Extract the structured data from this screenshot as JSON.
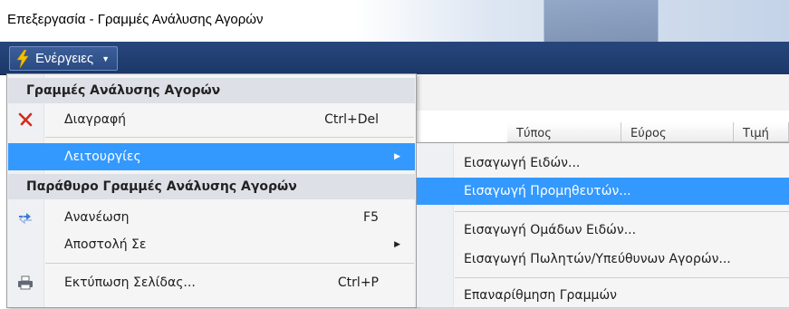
{
  "window": {
    "title": "Επεξεργασία - Γραμμές Ανάλυσης Αγορών"
  },
  "toolbar": {
    "actions_label": "Ενέργειες",
    "actions_icon": "lightning-icon"
  },
  "columns": [
    {
      "label": "Τύπος"
    },
    {
      "label": "Εύρος"
    },
    {
      "label": "Τιμή"
    }
  ],
  "menu": {
    "section1_header": "Γραμμές Ανάλυσης Αγορών",
    "delete": {
      "label": "Διαγραφή",
      "shortcut": "Ctrl+Del",
      "icon": "delete-x-icon"
    },
    "functions": {
      "label": "Λειτουργίες"
    },
    "section2_header": "Παράθυρο Γραμμές Ανάλυσης Αγορών",
    "refresh": {
      "label": "Ανανέωση",
      "shortcut": "F5",
      "icon": "refresh-icon"
    },
    "send_to": {
      "label": "Αποστολή Σε"
    },
    "print_page": {
      "label": "Εκτύπωση Σελίδας...",
      "shortcut": "Ctrl+P",
      "icon": "printer-icon"
    }
  },
  "submenu": {
    "items": [
      {
        "label": "Εισαγωγή Ειδών..."
      },
      {
        "label": "Εισαγωγή Προμηθευτών..."
      },
      {
        "label": "Εισαγωγή Ομάδων Ειδών..."
      },
      {
        "label": "Εισαγωγή Πωλητών/Υπεύθυνων Αγορών..."
      },
      {
        "label": "Επαναρίθμηση Γραμμών"
      }
    ]
  },
  "colors": {
    "toolbar": "#1c3868",
    "selection": "#3399ff",
    "menu_bg": "#f5f5f5",
    "header_bg": "#dde0e6",
    "bolt": "#f5c000",
    "delete_x": "#d42a1e"
  }
}
